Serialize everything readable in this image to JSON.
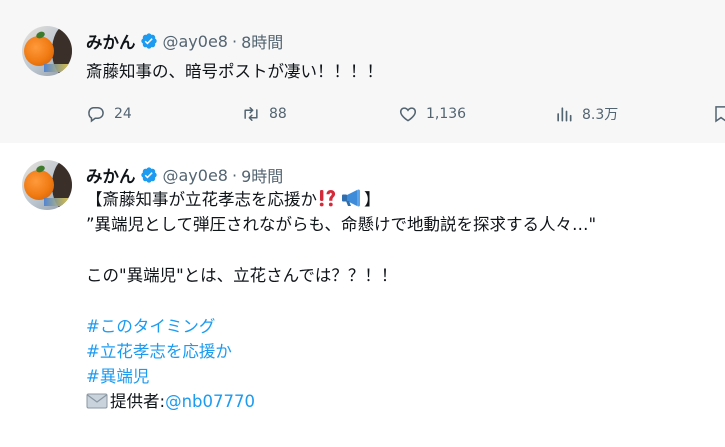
{
  "tweets": [
    {
      "name": "みかん",
      "handle": "@ay0e8",
      "separator": "·",
      "time": "8時間",
      "text": "斎藤知事の、暗号ポストが凄い！！！！",
      "metrics": {
        "replies": "24",
        "retweets": "88",
        "likes": "1,136",
        "views": "8.3万"
      }
    },
    {
      "name": "みかん",
      "handle": "@ay0e8",
      "separator": "·",
      "time": "9時間",
      "lines": {
        "l1_open": "【斎藤知事が立花孝志を応援か",
        "l1_close": "】",
        "l2": "”異端児として弾圧されながらも、命懸けで地動説を探求する人々…\"",
        "l3": "この\"異端児\"とは、立花さんでは？？！！",
        "hashtag1": "#このタイミング",
        "hashtag2": "#立花孝志を応援か",
        "hashtag3": "#異端児",
        "provider_label": "提供者:",
        "provider_mention": "@nb07770"
      }
    }
  ],
  "colors": {
    "link": "#1d9bf0",
    "verified": "#1d9bf0",
    "muted": "#536471",
    "highlight_bg": "#f7f7f7"
  },
  "icons": [
    "verified-badge-icon",
    "reply-icon",
    "retweet-icon",
    "like-icon",
    "views-icon",
    "bookmark-icon",
    "exclamation-question-icon",
    "megaphone-icon",
    "envelope-icon"
  ]
}
